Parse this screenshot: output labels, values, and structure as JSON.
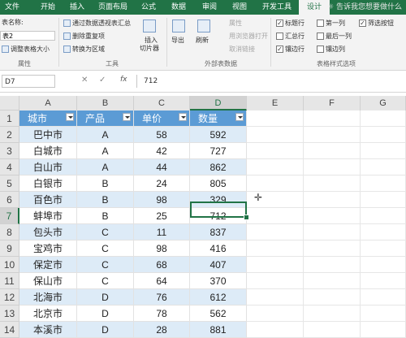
{
  "tabs": [
    "文件",
    "开始",
    "插入",
    "页面布局",
    "公式",
    "数据",
    "审阅",
    "视图",
    "开发工具",
    "设计"
  ],
  "active_tab": "设计",
  "tell_me": "告诉我您想要做什么",
  "ribbon": {
    "props": {
      "label1": "表名称:",
      "name_value": "表2",
      "resize": "调整表格大小",
      "group": "属性"
    },
    "tools": {
      "pivot": "通过数据透视表汇总",
      "dup": "删除重复项",
      "convert": "转换为区域",
      "slicer1": "插入",
      "slicer2": "切片器",
      "group": "工具"
    },
    "external": {
      "export": "导出",
      "refresh": "刷新",
      "props": "属性",
      "browser": "用浏览器打开",
      "unlink": "取消链接",
      "group": "外部表数据"
    },
    "style_opts": {
      "header_row": "标题行",
      "first_col": "第一列",
      "filter_btn": "筛选按钮",
      "total_row": "汇总行",
      "last_col": "最后一列",
      "banded_rows": "镶边行",
      "banded_cols": "镶边列",
      "group": "表格样式选项"
    }
  },
  "formula_bar": {
    "name_box": "D7",
    "cancel": "✕",
    "enter": "✓",
    "fx": "fx",
    "value": "712"
  },
  "columns": [
    "A",
    "B",
    "C",
    "D",
    "E",
    "F",
    "G"
  ],
  "selected_col": "D",
  "selected_row": "7",
  "row_numbers": [
    "1",
    "2",
    "3",
    "4",
    "5",
    "6",
    "7",
    "8",
    "9",
    "10",
    "11",
    "12",
    "13",
    "14"
  ],
  "table": {
    "headers": [
      "城市",
      "产品",
      "单价",
      "数量"
    ],
    "rows": [
      [
        "巴中市",
        "A",
        "58",
        "592"
      ],
      [
        "白城市",
        "A",
        "42",
        "727"
      ],
      [
        "白山市",
        "A",
        "44",
        "862"
      ],
      [
        "白银市",
        "B",
        "24",
        "805"
      ],
      [
        "百色市",
        "B",
        "98",
        "329"
      ],
      [
        "蚌埠市",
        "B",
        "25",
        "712"
      ],
      [
        "包头市",
        "C",
        "11",
        "837"
      ],
      [
        "宝鸡市",
        "C",
        "98",
        "416"
      ],
      [
        "保定市",
        "C",
        "68",
        "407"
      ],
      [
        "保山市",
        "C",
        "64",
        "370"
      ],
      [
        "北海市",
        "D",
        "76",
        "612"
      ],
      [
        "北京市",
        "D",
        "78",
        "562"
      ],
      [
        "本溪市",
        "D",
        "28",
        "881"
      ]
    ]
  },
  "colors": {
    "excel_green": "#217346",
    "table_header": "#5b9bd5",
    "band": "#ddebf7"
  }
}
